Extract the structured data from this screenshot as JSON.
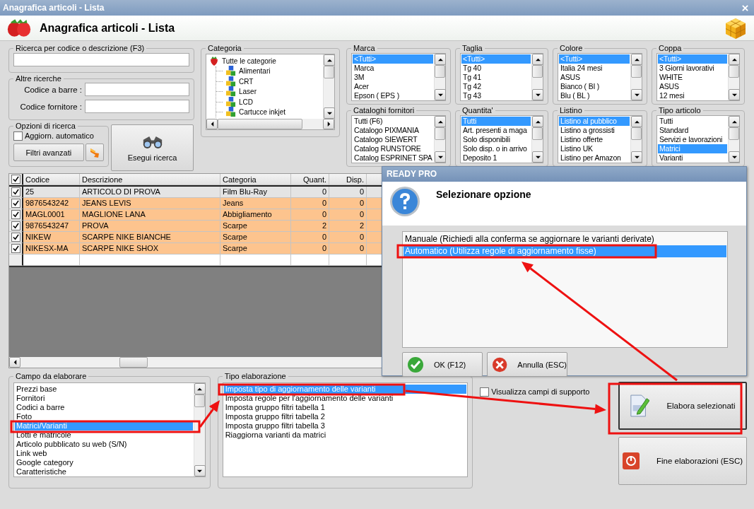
{
  "window": {
    "title": "Anagrafica articoli  - Lista"
  },
  "header": {
    "title": "Anagrafica articoli  - Lista"
  },
  "search": {
    "title": "Ricerca per codice o descrizione (F3)"
  },
  "other_searches": {
    "title": "Altre ricerche",
    "fields": [
      {
        "label": "Codice a barre :"
      },
      {
        "label": "Codice fornitore :"
      }
    ]
  },
  "search_options": {
    "title": "Opzioni di ricerca",
    "auto_update": {
      "label": "Aggiorn. automatico",
      "checked": false
    },
    "advanced_filters_button": "Filtri avanzati"
  },
  "search_button": "Esegui ricerca",
  "category": {
    "title": "Categoria",
    "items": [
      {
        "label": "Tutte le categorie",
        "children": [
          {
            "label": "Alimentari"
          },
          {
            "label": "CRT"
          },
          {
            "label": "Laser"
          },
          {
            "label": "LCD"
          },
          {
            "label": "Cartucce inkjet"
          }
        ]
      }
    ]
  },
  "filters": [
    {
      "title": "Marca",
      "items": [
        {
          "label": "<Tutti>",
          "selected": true
        },
        {
          "label": "Marca",
          "selected": false
        },
        {
          "label": "3M",
          "selected": false
        },
        {
          "label": "Acer",
          "selected": false
        },
        {
          "label": "Epson ( EPS )",
          "selected": false
        }
      ]
    },
    {
      "title": "Taglia",
      "items": [
        {
          "label": "<Tutti>",
          "selected": true
        },
        {
          "label": "Tg 40",
          "selected": false
        },
        {
          "label": "Tg 41",
          "selected": false
        },
        {
          "label": "Tg 42",
          "selected": false
        },
        {
          "label": "Tg 43",
          "selected": false
        }
      ]
    },
    {
      "title": "Colore",
      "items": [
        {
          "label": "<Tutti>",
          "selected": true
        },
        {
          "label": "Italia 24 mesi",
          "selected": false
        },
        {
          "label": "ASUS",
          "selected": false
        },
        {
          "label": "Bianco ( BI )",
          "selected": false
        },
        {
          "label": "Blu ( BL )",
          "selected": false
        }
      ]
    },
    {
      "title": "Coppa",
      "items": [
        {
          "label": "<Tutti>",
          "selected": true
        },
        {
          "label": "3 Giorni lavorativi",
          "selected": false
        },
        {
          "label": "WHITE",
          "selected": false
        },
        {
          "label": "ASUS",
          "selected": false
        },
        {
          "label": "12 mesi",
          "selected": false
        }
      ]
    },
    {
      "title": "Cataloghi fornitori",
      "items": [
        {
          "label": "Tutti (F6)",
          "selected": false
        },
        {
          "label": "Catalogo PIXMANIA",
          "selected": false
        },
        {
          "label": "Catalogo SIEWERT",
          "selected": false
        },
        {
          "label": "Catalog RUNSTORE",
          "selected": false
        },
        {
          "label": "Catalog ESPRINET SPA",
          "selected": false
        }
      ]
    },
    {
      "title": "Quantita'",
      "items": [
        {
          "label": "Tutti",
          "selected": true
        },
        {
          "label": "Art. presenti a maga",
          "selected": false
        },
        {
          "label": "Solo disponibili",
          "selected": false
        },
        {
          "label": "Solo disp. o in arrivo",
          "selected": false
        },
        {
          "label": "Deposito 1",
          "selected": false
        }
      ]
    },
    {
      "title": "Listino",
      "items": [
        {
          "label": "Listino al pubblico",
          "selected": true
        },
        {
          "label": "Listino a grossisti",
          "selected": false
        },
        {
          "label": "Listino offerte",
          "selected": false
        },
        {
          "label": "Listino UK",
          "selected": false
        },
        {
          "label": "Listino per Amazon",
          "selected": false
        }
      ]
    },
    {
      "title": "Tipo articolo",
      "items": [
        {
          "label": "Tutti",
          "selected": false
        },
        {
          "label": "Standard",
          "selected": false
        },
        {
          "label": "Servizi e lavorazioni",
          "selected": false
        },
        {
          "label": "Matrici",
          "selected": true
        },
        {
          "label": "Varianti",
          "selected": false
        }
      ]
    }
  ],
  "table": {
    "all_checked": true,
    "columns": [
      "Codice",
      "Descrizione",
      "Categoria",
      "Quant.",
      "Disp."
    ],
    "rows": [
      {
        "checked": true,
        "selected": true,
        "cells": [
          "25",
          "ARTICOLO DI PROVA",
          "Film Blu-Ray",
          "0",
          "0"
        ]
      },
      {
        "checked": true,
        "selected": false,
        "cells": [
          "9876543242",
          "JEANS LEVIS",
          "Jeans",
          "0",
          "0"
        ]
      },
      {
        "checked": true,
        "selected": false,
        "cells": [
          "MAGL0001",
          "MAGLIONE LANA",
          "Abbigliamento",
          "0",
          "0"
        ]
      },
      {
        "checked": true,
        "selected": false,
        "cells": [
          "9876543247",
          "PROVA",
          "Scarpe",
          "2",
          "2"
        ]
      },
      {
        "checked": true,
        "selected": false,
        "cells": [
          "NIKEW",
          "SCARPE NIKE BIANCHE",
          "Scarpe",
          "0",
          "0"
        ]
      },
      {
        "checked": true,
        "selected": false,
        "cells": [
          "NIKESX-MA",
          "SCARPE NIKE SHOX",
          "Scarpe",
          "0",
          "0"
        ]
      }
    ]
  },
  "process_field": {
    "title": "Campo da elaborare",
    "items": [
      {
        "label": "Prezzi base",
        "selected": false
      },
      {
        "label": "Fornitori",
        "selected": false
      },
      {
        "label": "Codici a barre",
        "selected": false
      },
      {
        "label": "Foto",
        "selected": false
      },
      {
        "label": "Matrici/Varianti",
        "selected": true
      },
      {
        "label": "Lotti e matricole",
        "selected": false
      },
      {
        "label": "Articolo pubblicato su web (S/N)",
        "selected": false
      },
      {
        "label": "Link web",
        "selected": false
      },
      {
        "label": "Google category",
        "selected": false
      },
      {
        "label": "Caratteristiche",
        "selected": false
      }
    ]
  },
  "process_type": {
    "title": "Tipo elaborazione",
    "items": [
      {
        "label": "Imposta tipo di aggiornamento delle varianti",
        "selected": true
      },
      {
        "label": "Imposta regole per l'aggiornamento delle varianti",
        "selected": false
      },
      {
        "label": "Imposta gruppo filtri tabella 1",
        "selected": false
      },
      {
        "label": "Imposta gruppo filtri tabella 2",
        "selected": false
      },
      {
        "label": "Imposta gruppo filtri tabella 3",
        "selected": false
      },
      {
        "label": "Riaggiorna varianti da matrici",
        "selected": false
      }
    ]
  },
  "support_fields": {
    "label": "Visualizza campi di supporto",
    "checked": false
  },
  "buttons": [
    {
      "label": "Elabora selezionati",
      "kind": "edit"
    },
    {
      "label": "Fine elaborazioni (ESC)",
      "kind": "stop"
    }
  ],
  "dialog": {
    "title": "READY PRO",
    "heading": "Selezionare opzione",
    "options": [
      {
        "label": "Manuale (Richiedi alla conferma se aggiornare le varianti derivate)",
        "selected": false
      },
      {
        "label": "Automatico (Utilizza regole di aggiornamento fisse)",
        "selected": true
      }
    ],
    "buttons": [
      {
        "label": "OK (F12)",
        "kind": "ok"
      },
      {
        "label": "Annulla (ESC)",
        "kind": "cancel"
      }
    ]
  }
}
